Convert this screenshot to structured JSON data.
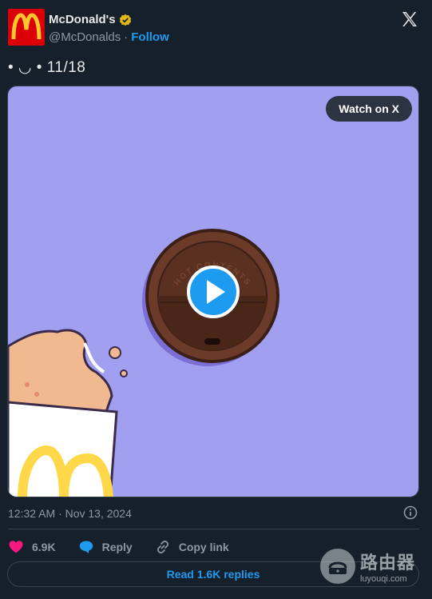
{
  "author": {
    "display_name": "McDonald's",
    "handle": "@McDonalds",
    "separator": "·",
    "follow_label": "Follow"
  },
  "tweet": {
    "text": "• ◡ • 11/18"
  },
  "media": {
    "watch_label": "Watch on X",
    "lid_text": "HOT CONTENTS"
  },
  "meta": {
    "timestamp": "12:32 AM · Nov 13, 2024"
  },
  "actions": {
    "likes": "6.9K",
    "reply_label": "Reply",
    "copy_link_label": "Copy link",
    "read_replies_label": "Read 1.6K replies"
  },
  "watermark": {
    "cn_text": "路由器",
    "url": "luyouqi.com"
  },
  "colors": {
    "background": "#15202b",
    "accent": "#1d9bf0",
    "like": "#f91880",
    "media_bg": "#a09ff0",
    "brand_red": "#db0007",
    "brand_yellow": "#ffc72c"
  }
}
